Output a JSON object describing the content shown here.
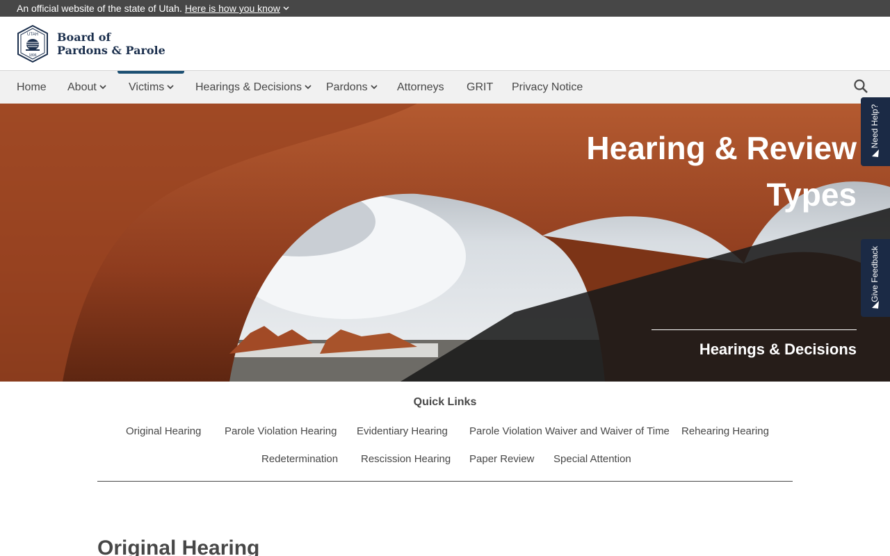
{
  "gov_banner": {
    "text": "An official website of the state of Utah.",
    "link": "Here is how you know"
  },
  "logo": {
    "line1": "Board of",
    "line2": "Pardons & Parole",
    "seal_top": "UTAH",
    "seal_year": "1896"
  },
  "nav": {
    "items": [
      {
        "label": "Home",
        "dropdown": false
      },
      {
        "label": "About",
        "dropdown": true
      },
      {
        "label": "Victims",
        "dropdown": true,
        "active": true
      },
      {
        "label": "Hearings & Decisions",
        "dropdown": true
      },
      {
        "label": "Pardons",
        "dropdown": true
      },
      {
        "label": "Attorneys",
        "dropdown": false
      },
      {
        "label": "GRIT",
        "dropdown": false
      },
      {
        "label": "Privacy Notice",
        "dropdown": false
      }
    ],
    "search_icon": "search-icon"
  },
  "hero": {
    "title_line1": "Hearing & Review",
    "title_line2": "Types",
    "subtitle": "Hearings & Decisions"
  },
  "side_tabs": {
    "need_help": "Need Help?",
    "give_feedback": "Give Feedback"
  },
  "quick_links": {
    "title": "Quick Links",
    "row1": [
      "Original Hearing",
      "Parole Violation Hearing",
      "Evidentiary Hearing",
      "Parole Violation Waiver and Waiver of Time",
      "Rehearing Hearing"
    ],
    "row2": [
      "Redetermination",
      "Rescission Hearing",
      "Paper Review",
      "Special Attention"
    ]
  },
  "section": {
    "heading": "Original Hearing"
  },
  "colors": {
    "banner_bg": "#474747",
    "nav_bg": "#f1f1f1",
    "active_indicator": "#1b4f72",
    "side_tab_bg": "#1b2a45",
    "brand_navy": "#1b2f4d"
  }
}
